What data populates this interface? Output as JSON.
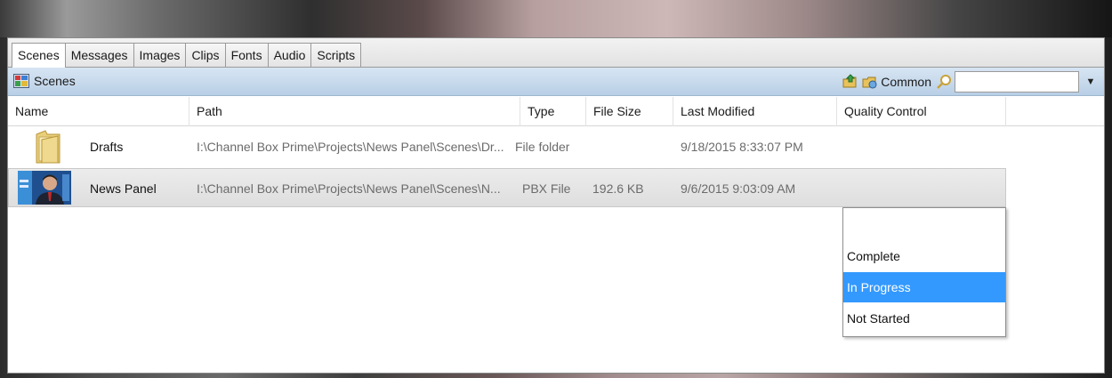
{
  "tabs": [
    {
      "label": "Scenes",
      "active": true
    },
    {
      "label": "Messages",
      "active": false
    },
    {
      "label": "Images",
      "active": false
    },
    {
      "label": "Clips",
      "active": false
    },
    {
      "label": "Fonts",
      "active": false
    },
    {
      "label": "Audio",
      "active": false
    },
    {
      "label": "Scripts",
      "active": false
    }
  ],
  "header": {
    "title": "Scenes",
    "title_icon": "scenes-icon",
    "common_label": "Common",
    "search": {
      "value": "",
      "placeholder": ""
    }
  },
  "columns": [
    "Name",
    "Path",
    "Type",
    "File Size",
    "Last Modified",
    "Quality Control"
  ],
  "rows": [
    {
      "icon": "folder-icon",
      "name": "Drafts",
      "path": "I:\\Channel Box Prime\\Projects\\News Panel\\Scenes\\Dr...",
      "type": "File folder",
      "file_size": "",
      "last_modified": "9/18/2015 8:33:07 PM",
      "quality_control": "",
      "selected": false
    },
    {
      "icon": "news-thumbnail",
      "name": "News Panel",
      "path": "I:\\Channel Box Prime\\Projects\\News Panel\\Scenes\\N...",
      "type": "PBX File",
      "file_size": "192.6 KB",
      "last_modified": "9/6/2015 9:03:09 AM",
      "quality_control": "",
      "selected": true
    }
  ],
  "quality_control_dropdown": {
    "options": [
      "",
      "Complete",
      "In Progress",
      "Not Started"
    ],
    "highlighted": "In Progress"
  },
  "colors": {
    "header_bar": "#c6d9ed",
    "highlight": "#3399ff"
  }
}
